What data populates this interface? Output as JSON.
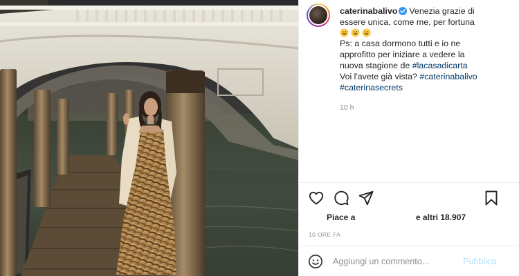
{
  "post": {
    "username": "caterinabalivo",
    "caption_lines": [
      "Venezia grazie di",
      "essere unica, come me, per fortuna",
      "Ps: a casa dormono tutti e io ne",
      "approfitto per iniziare a vedere la",
      "nuova stagione de ",
      "Voi l'avete già vista? "
    ],
    "hashtags": [
      "#lacasadicarta",
      "#caterinabalivo",
      "#caterinasecrets"
    ],
    "emojis": [
      "grinning-sweat-emoji",
      "grinning-sweat-emoji",
      "grinning-sweat-emoji"
    ],
    "time_short": "10 h"
  },
  "actions": {
    "icons": [
      "heart-icon",
      "comment-icon",
      "share-icon",
      "bookmark-icon"
    ]
  },
  "likes": {
    "prefix": "Piace a",
    "suffix": "e altri 18.907"
  },
  "timestamp_label": "10 ORE FA",
  "comment": {
    "placeholder": "Aggiungi un commento...",
    "publish_label": "Pubblica"
  },
  "colors": {
    "link": "#00376b",
    "verified": "#3897f0",
    "publish_disabled": "#b2dffc",
    "muted": "#8e8e8e"
  }
}
